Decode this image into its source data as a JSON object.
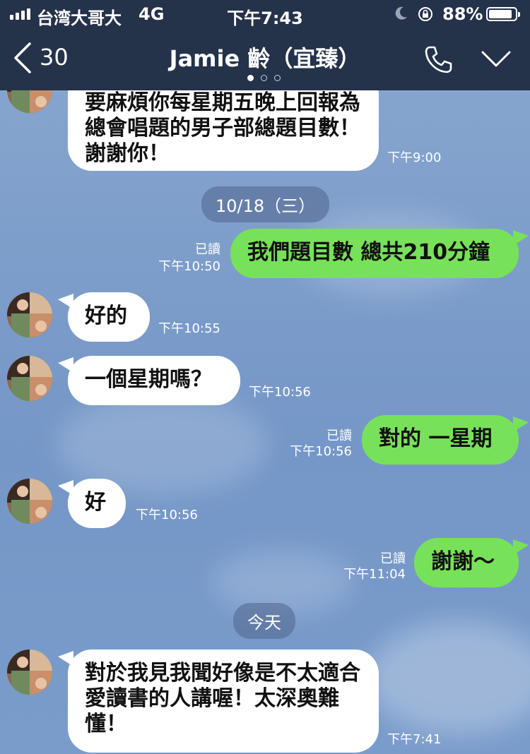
{
  "status_bar": {
    "carrier": "台湾大哥大",
    "network": "4G",
    "time": "下午7:43",
    "battery_percent": "88%",
    "battery_level": 0.88
  },
  "nav": {
    "back_count": "30",
    "title": "Jamie 齡（宜臻）",
    "page_indicator_count": 3,
    "page_indicator_active": 0
  },
  "messages": [
    {
      "id": "m1",
      "direction": "in",
      "text": "要麻煩你每星期五晚上回報為總會唱題的男子部總題目數！謝謝你！",
      "time": "下午9:00"
    },
    {
      "id": "d1",
      "type": "date",
      "text": "10/18（三）"
    },
    {
      "id": "m2",
      "direction": "out",
      "text": "我們題目數 總共210分鐘",
      "read": "已讀",
      "time": "下午10:50"
    },
    {
      "id": "m3",
      "direction": "in",
      "text": "好的",
      "time": "下午10:55"
    },
    {
      "id": "m4",
      "direction": "in",
      "text": "一個星期嗎？",
      "time": "下午10:56"
    },
    {
      "id": "m5",
      "direction": "out",
      "text": "對的 一星期",
      "read": "已讀",
      "time": "下午10:56"
    },
    {
      "id": "m6",
      "direction": "in",
      "text": "好",
      "time": "下午10:56"
    },
    {
      "id": "m7",
      "direction": "out",
      "text": "謝謝～",
      "read": "已讀",
      "time": "下午11:04"
    },
    {
      "id": "d2",
      "type": "date",
      "text": "今天"
    },
    {
      "id": "m8",
      "direction": "in",
      "text": "對於我見我聞好像是不太適合愛讀書的人講喔！太深奧難懂！",
      "time": "下午7:41"
    }
  ],
  "colors": {
    "header_bg": "#24324a",
    "chat_bg": "#7d9dca",
    "outgoing_bubble": "#78e15a",
    "incoming_bubble": "#ffffff"
  },
  "icons": [
    "signal-icon",
    "moon-icon",
    "orientation-lock-icon",
    "battery-icon",
    "back-chevron-icon",
    "phone-icon",
    "chevron-down-icon"
  ]
}
